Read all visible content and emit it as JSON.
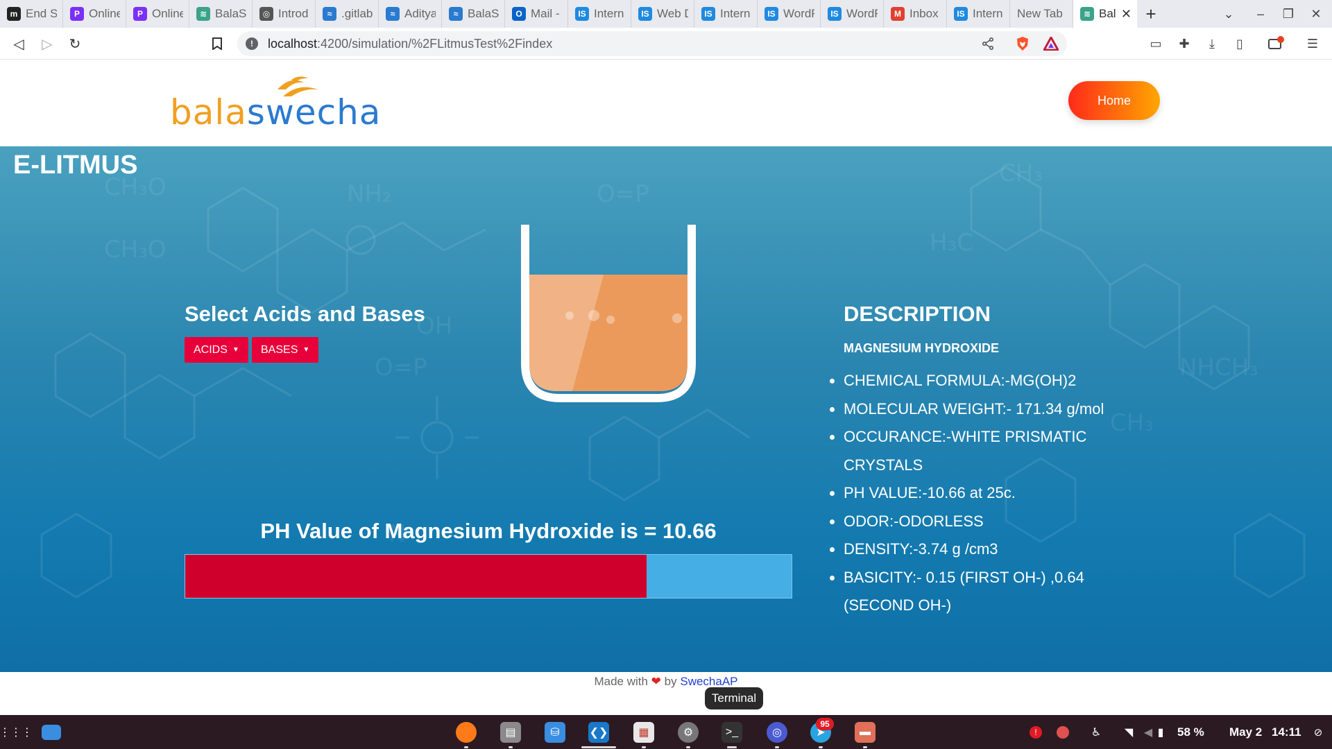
{
  "browser": {
    "tabs": [
      {
        "title": "End S",
        "icon": "mastodon-icon",
        "color": "#222"
      },
      {
        "title": "Online",
        "icon": "pocketbase-icon",
        "color": "#7b2ff7"
      },
      {
        "title": "Online",
        "icon": "pocketbase-icon",
        "color": "#7b2ff7"
      },
      {
        "title": "BalaS",
        "icon": "balaswecha-icon",
        "color": "#3aa38a"
      },
      {
        "title": "Introd",
        "icon": "globe-icon",
        "color": "#555"
      },
      {
        "title": ".gitlab",
        "icon": "swecha-icon",
        "color": "#2a7ad0"
      },
      {
        "title": "Aditya",
        "icon": "swecha-icon",
        "color": "#2a7ad0"
      },
      {
        "title": "BalaS",
        "icon": "swecha-icon",
        "color": "#2a7ad0"
      },
      {
        "title": "Mail -",
        "icon": "outlook-icon",
        "color": "#0a64c8"
      },
      {
        "title": "Intern",
        "icon": "is-icon",
        "color": "#1f8ae0"
      },
      {
        "title": "Web D",
        "icon": "is-icon",
        "color": "#1f8ae0"
      },
      {
        "title": "Intern",
        "icon": "is-icon",
        "color": "#1f8ae0"
      },
      {
        "title": "WordF",
        "icon": "is-icon",
        "color": "#1f8ae0"
      },
      {
        "title": "WordF",
        "icon": "is-icon",
        "color": "#1f8ae0"
      },
      {
        "title": "Inbox",
        "icon": "gmail-icon",
        "color": "#e04030"
      },
      {
        "title": "Intern",
        "icon": "is-icon",
        "color": "#1f8ae0"
      },
      {
        "title": "New Tab",
        "icon": "",
        "color": ""
      }
    ],
    "active_tab": {
      "title": "Bal",
      "icon": "balaswecha-icon"
    },
    "url_host": "localhost",
    "url_path": ":4200/simulation/%2FLitmusTest%2Findex"
  },
  "site": {
    "logo_part1": "bala",
    "logo_part2": "swecha",
    "home_label": "Home",
    "page_title": "E-LITMUS",
    "select_heading": "Select Acids and Bases",
    "acids_label": "ACIDS",
    "bases_label": "BASES",
    "ph_text": "PH Value of Magnesium Hydroxide is = 10.66",
    "ph_value": 10.66,
    "ph_max": 14,
    "solution_color": "#ec9a5c",
    "desc_title": "DESCRIPTION",
    "desc_name": "MAGNESIUM HYDROXIDE",
    "desc_items": [
      "CHEMICAL FORMULA:-MG(OH)2",
      "MOLECULAR WEIGHT:- 171.34 g/mol",
      "OCCURANCE:-WHITE PRISMATIC CRYSTALS",
      "PH VALUE:-10.66 at 25c.",
      "ODOR:-ODORLESS",
      "DENSITY:-3.74 g /cm3",
      "BASICITY:- 0.15 (FIRST OH-) ,0.64 (SECOND OH-)"
    ],
    "footer_made": "Made with",
    "footer_by": "by",
    "footer_link": "SwechaAP",
    "tooltip": "Terminal"
  },
  "taskbar": {
    "telegram_badge": "95",
    "battery": "58 %",
    "date": "May 2",
    "time": "14:11"
  }
}
